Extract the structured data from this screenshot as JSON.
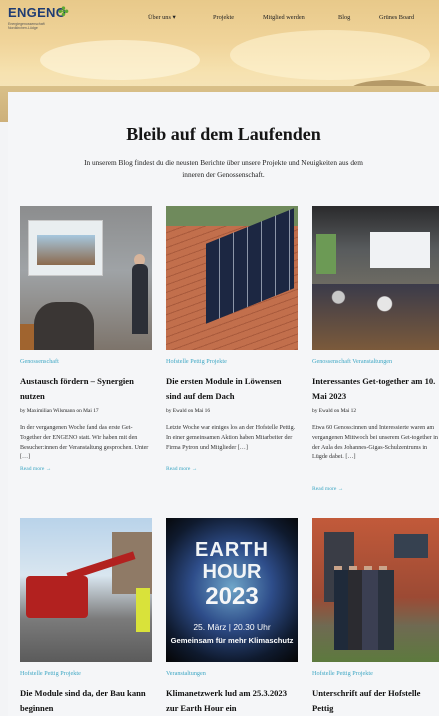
{
  "brand": {
    "name": "ENGENO",
    "tagline": "Energiegenossenschaft Nordkirchen-Lüdge"
  },
  "nav": {
    "items": [
      "Über uns ▾",
      "Projekte",
      "Mitglied werden",
      "Blog",
      "Grünes Board"
    ]
  },
  "section": {
    "title": "Bleib auf dem Laufenden",
    "intro": "In unserem Blog findest du die neusten Berichte über unsere Projekte und Neuigkeiten aus dem inneren der Genossenschaft."
  },
  "posts": [
    {
      "categories": "Genossenschaft",
      "title": "Austausch fördern – Synergien nutzen",
      "meta": "by Maximilian Wilsmann   on Mai 17",
      "excerpt": "In der vergangenen Woche fand das erste Get-Together der ENGENO statt. Wir haben mit den Besucher:innen der Veranstaltung gesprochen. Unter […]",
      "more": "Read more →"
    },
    {
      "categories": "Hofstelle Pettig  Projekte",
      "title": "Die ersten Module in Löwensen sind auf dem Dach",
      "meta": "by Ewald   on Mai 16",
      "excerpt": "Letzte Woche war einiges los an der Hofstelle Pettig. In einer gemeinsamen Aktion haben Mitarbeiter der Firma Pytron und Mitglieder […]",
      "more": "Read more →"
    },
    {
      "categories": "Genossenschaft  Veranstaltungen",
      "title": "Interessantes Get-together am 10. Mai 2023",
      "meta": "by Ewald   on Mai 12",
      "excerpt": "Etwa 60 Genoss:innen und Interessierte waren am vergangenen Mittwoch bei unserem Get-together in der Aula des Johannes-Gigas-Schulzentrums in Lügde dabei. […]",
      "more": "Read more →"
    },
    {
      "categories": "Hofstelle Pettig  Projekte",
      "title": "Die Module sind da, der Bau kann beginnen",
      "meta": "",
      "excerpt": "",
      "more": ""
    },
    {
      "categories": "Veranstaltungen",
      "title": "Klimanetzwerk lud am 25.3.2023 zur Earth Hour ein",
      "meta": "",
      "excerpt": "",
      "more": "",
      "poster": {
        "line1": "EARTH",
        "line2": "HOUR",
        "line3": "2023",
        "line4": "25. März | 20.30 Uhr",
        "line5": "Gemeinsam für mehr Klimaschutz"
      }
    },
    {
      "categories": "Hofstelle Pettig  Projekte",
      "title": "Unterschrift auf der Hofstelle Pettig",
      "meta": "",
      "excerpt": "",
      "more": ""
    }
  ],
  "colors": {
    "accent": "#3ea7c4",
    "brand": "#1f3c73",
    "leaf": "#5fa832"
  }
}
